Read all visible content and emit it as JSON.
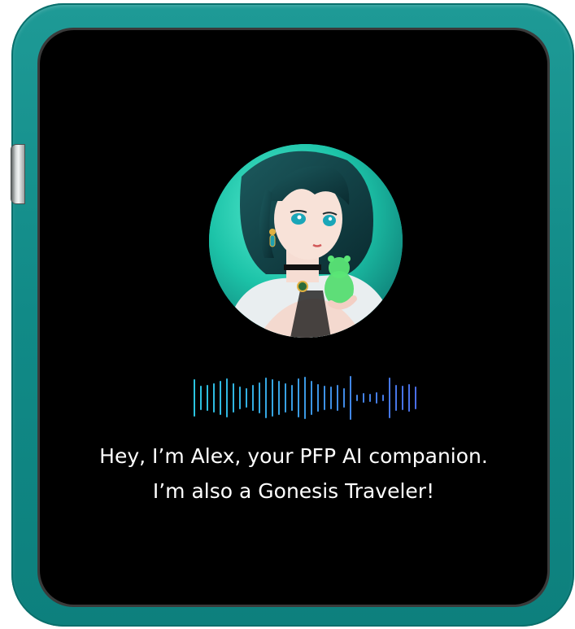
{
  "companion": {
    "avatar_icon": "anime-girl-avatar",
    "colors": {
      "device": "#118a87",
      "screen": "#000000",
      "wave_start": "#2bc4e0",
      "wave_end": "#4a6ee8",
      "text": "#ffffff"
    },
    "message": {
      "line1": "Hey, I’m Alex, your PFP AI companion.",
      "line2": "I’m also a Gonesis Traveler!"
    }
  }
}
